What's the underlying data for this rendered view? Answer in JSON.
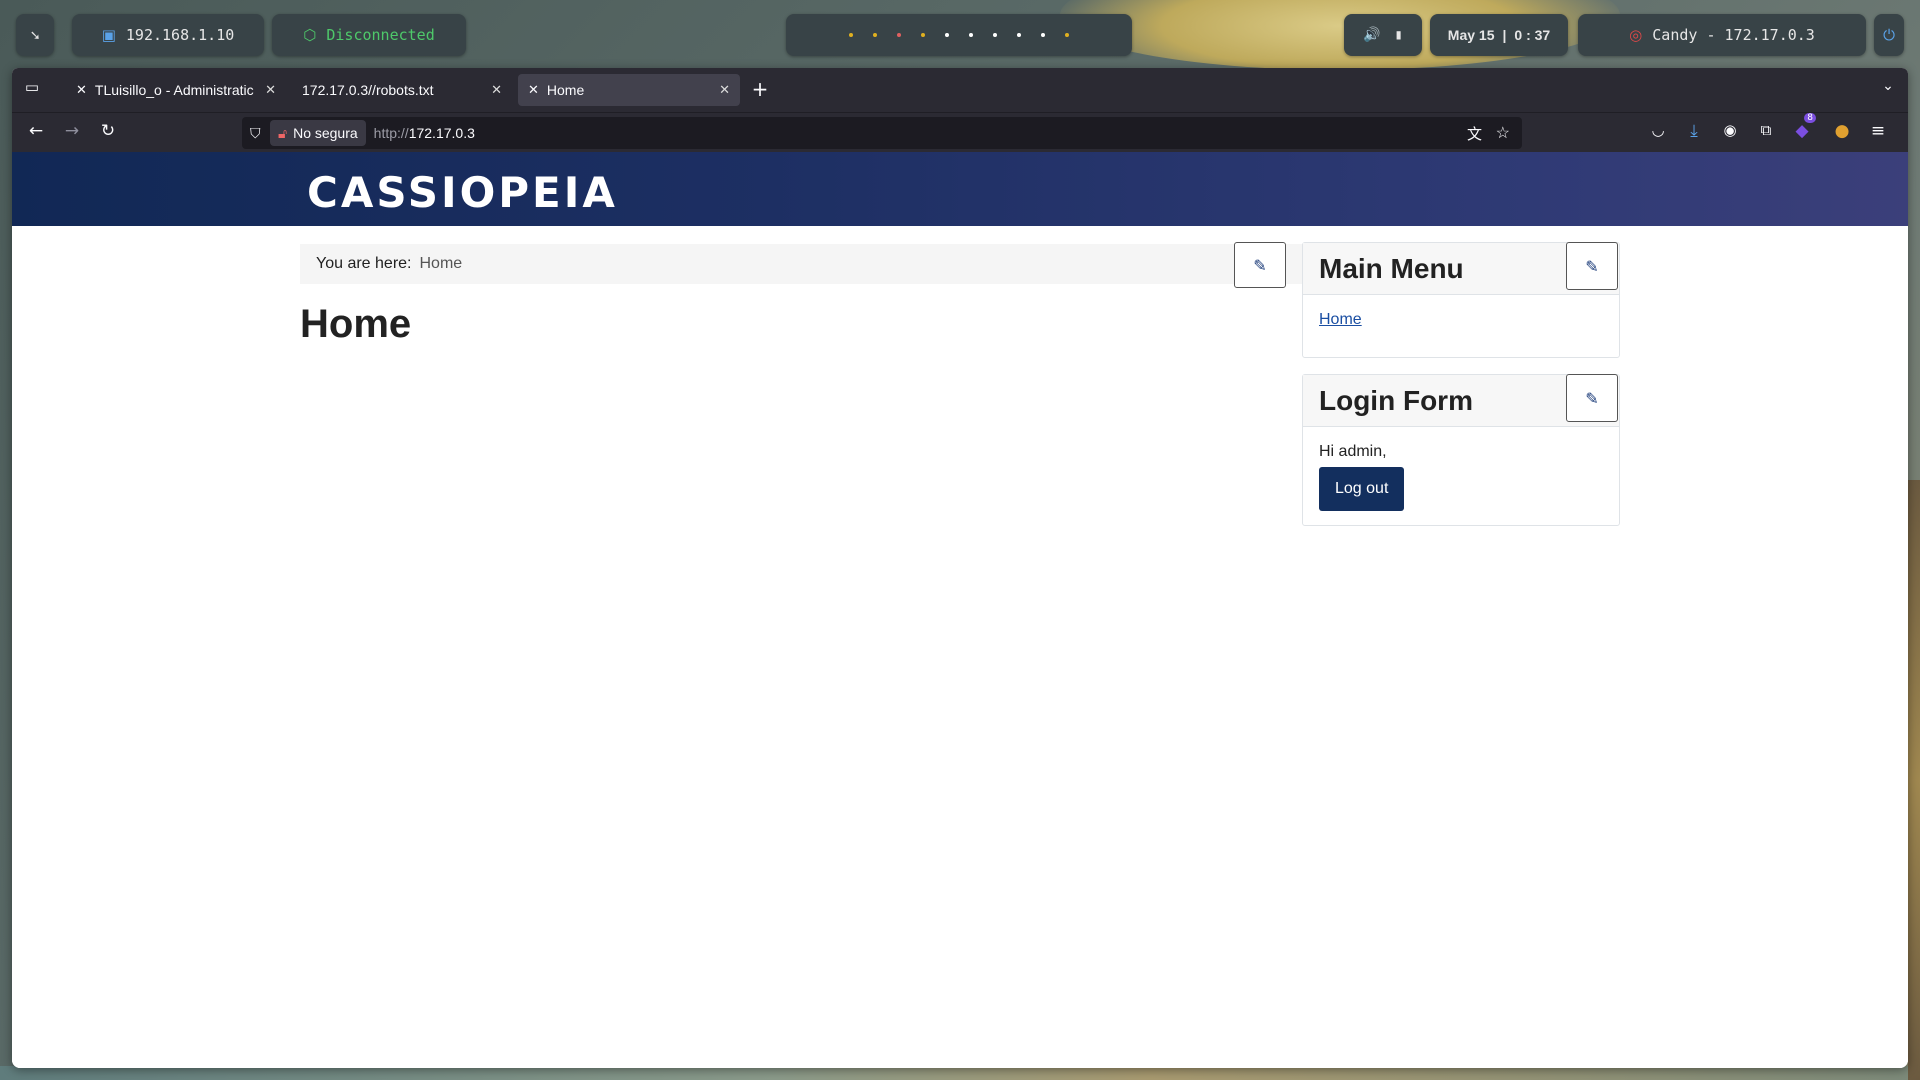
{
  "taskbar": {
    "ip_label": "192.168.1.10",
    "vpn_status": "Disconnected",
    "date": "May 15",
    "time": "0 : 37",
    "target": "Candy - 172.17.0.3",
    "dots_colors": [
      "#e0b020",
      "#e0b020",
      "#e06060",
      "#e0b020",
      "#ffffff",
      "#ffffff",
      "#ffffff",
      "#ffffff",
      "#ffffff",
      "#e0b020"
    ]
  },
  "browser": {
    "tabs": [
      {
        "title": "TLuisillo_o - Administratic",
        "icon": "joomla-icon"
      },
      {
        "title": "172.17.0.3//robots.txt",
        "icon": ""
      },
      {
        "title": "Home",
        "icon": "joomla-icon"
      }
    ],
    "security_label": "No segura",
    "url_scheme": "http://",
    "url_host": "172.17.0.3",
    "extension_badge": "8"
  },
  "site": {
    "brand": "CASSIOPEIA",
    "breadcrumb_label": "You are here:",
    "breadcrumb_item": "Home",
    "page_title": "Home",
    "main_menu_title": "Main Menu",
    "main_menu_items": [
      "Home"
    ],
    "login_title": "Login Form",
    "greeting": "Hi admin,",
    "logout_label": "Log out"
  },
  "colors": {
    "header_start": "#112855",
    "header_end": "#3b3f7a",
    "button": "#132f5e",
    "link": "#1a4ea2"
  }
}
